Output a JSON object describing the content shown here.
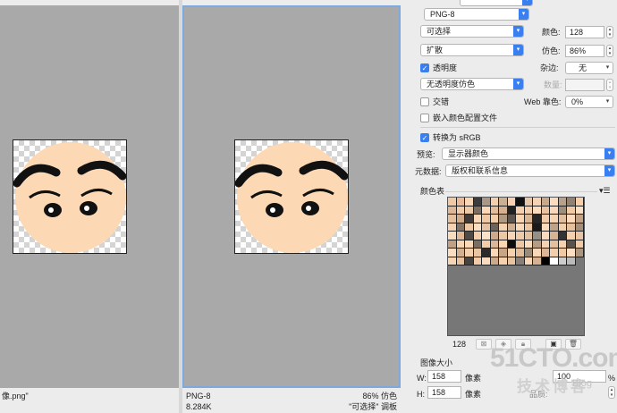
{
  "left_pane": {
    "filename_fragment": "像.png\""
  },
  "right_pane": {
    "format": "PNG-8",
    "size": "8.284K",
    "dither_info": "86% 仿色",
    "palette_info": "\"可选择\" 调板"
  },
  "settings": {
    "format": "PNG-8",
    "reduction": "可选择",
    "dither_algo": "扩散",
    "colors_label": "颜色:",
    "colors_value": "128",
    "dither_label": "仿色:",
    "dither_value": "86%",
    "transparency_label": "透明度",
    "transparency_checked": true,
    "matte_label": "杂边:",
    "matte_value": "无",
    "transparency_dither": "无透明度仿色",
    "amount_label": "数量:",
    "interlaced_label": "交错",
    "interlaced_checked": false,
    "web_snap_label": "Web 靠色:",
    "web_snap_value": "0%",
    "embed_profile_label": "嵌入颜色配置文件",
    "embed_profile_checked": false,
    "convert_srgb_label": "转换为 sRGB",
    "convert_srgb_checked": true,
    "preview_label": "预览:",
    "preview_value": "显示器颜色",
    "metadata_label": "元数据:",
    "metadata_value": "版权和联系信息",
    "color_table_label": "颜色表",
    "color_count": "128",
    "image_size_label": "图像大小",
    "width_label": "W:",
    "width_value": "158",
    "height_label": "H:",
    "height_value": "158",
    "unit_label": "像素",
    "percent_label": "%",
    "percent_value": "100",
    "quality_fragment": "品质:"
  },
  "watermark": {
    "line1": "51CTO.com",
    "line2": "技术博客",
    "line3": "Blog"
  },
  "colors": {
    "accent": "#3a7ff0",
    "preview_bg": "#a9a9a9",
    "skin": "#fcd9b4",
    "selection_border": "#7da9df",
    "swatches": [
      "#f3c9a4",
      "#e9b998",
      "#f8d6b6",
      "#3c3c3c",
      "#a89888",
      "#f4d1ae",
      "#cbb193",
      "#f7d3b3",
      "#111111",
      "#e8c7a8",
      "#f5d4b5",
      "#c8a98a",
      "#fadcbe",
      "#b8a08a",
      "#918373",
      "#f7cfa9",
      "#ddb798",
      "#f0ccac",
      "#eecba8",
      "#7b6f64",
      "#fbd8b6",
      "#e2bd9b",
      "#d5b192",
      "#222222",
      "#f6d0ae",
      "#f3cfad",
      "#faddc0",
      "#ebc3a0",
      "#f7d8bb",
      "#9d8e7e",
      "#f1caa6",
      "#fae0c4",
      "#e6bf9c",
      "#cfab8b",
      "#3f3b38",
      "#f9d6b4",
      "#efc8a4",
      "#f4cda9",
      "#b19a83",
      "#5d5650",
      "#f8d4b0",
      "#d9b696",
      "#262626",
      "#f2cbaa",
      "#f7d5b3",
      "#e0be9f",
      "#fbdbbb",
      "#c4a385",
      "#f5d2b1",
      "#827567",
      "#eec7a3",
      "#fbdfc2",
      "#e4c2a2",
      "#6c645c",
      "#f6d3b0",
      "#d0ae90",
      "#f8d9bc",
      "#ecc6a2",
      "#1a1a1a",
      "#fadcbd",
      "#bca38a",
      "#f3ceac",
      "#e7c19e",
      "#a48f7a",
      "#f9dbbd",
      "#dfba99",
      "#4f4a45",
      "#f5cfac",
      "#fbe1c6",
      "#cdaa8c",
      "#eec9a6",
      "#f7d6b7",
      "#f0caa7",
      "#e2c0a0",
      "#959085",
      "#fadabc",
      "#d7b394",
      "#333333",
      "#f4d0ae",
      "#e9c4a2",
      "#c1a184",
      "#f6d5b4",
      "#f9d9b9",
      "#7a6e62",
      "#f2cda9",
      "#dbb899",
      "#f8d5b3",
      "#0d0d0d",
      "#eec8a5",
      "#fbddbf",
      "#b49c85",
      "#f5d3b2",
      "#e5c09e",
      "#f7d2ae",
      "#5a534d",
      "#f1cba8",
      "#fadec1",
      "#d2af90",
      "#f3cfae",
      "#ebc5a1",
      "#2b2b2b",
      "#f8d8b9",
      "#c7a687",
      "#f6d1ae",
      "#e1bd9c",
      "#9a8a79",
      "#f9d8b8",
      "#dcb697",
      "#f4cfab",
      "#f0c9a5",
      "#fcdfc3",
      "#ad9680",
      "#f7d4b2",
      "#e6c29f",
      "#474340",
      "#f2ccaa",
      "#fadbbd",
      "#cba98a",
      "#f5d1af",
      "#e8c3a0",
      "#888078",
      "#f8d7b7",
      "#d6b293",
      "#000000",
      "#ffffff",
      "#cccccc",
      "#bbbbbb"
    ]
  }
}
